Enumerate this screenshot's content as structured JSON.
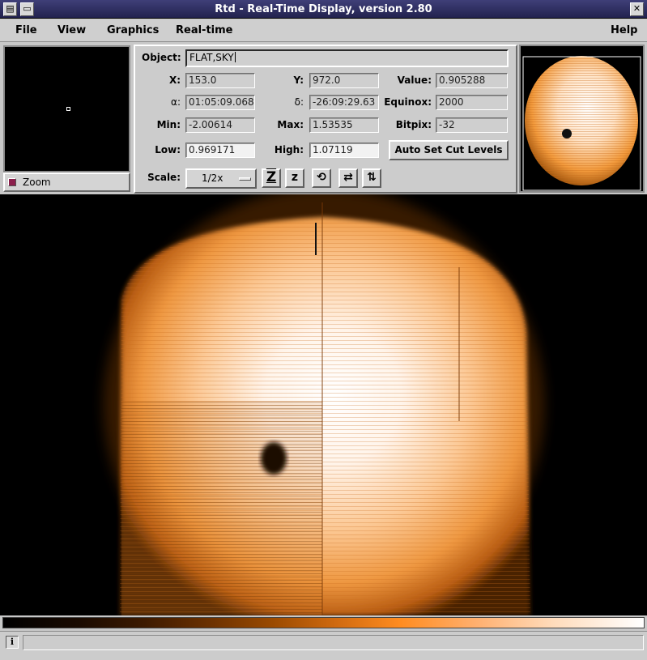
{
  "window": {
    "title": "Rtd - Real-Time Display, version 2.80"
  },
  "menu": {
    "file": "File",
    "view": "View",
    "graphics": "Graphics",
    "realtime": "Real-time",
    "help": "Help"
  },
  "zoom": {
    "label": "Zoom"
  },
  "info": {
    "object_label": "Object:",
    "object_value": "FLAT,SKY",
    "x_label": "X:",
    "x_value": "153.0",
    "y_label": "Y:",
    "y_value": "972.0",
    "value_label": "Value:",
    "value_value": "0.905288",
    "alpha_label": "α:",
    "alpha_value": "01:05:09.068",
    "delta_label": "δ:",
    "delta_value": "-26:09:29.63",
    "equinox_label": "Equinox:",
    "equinox_value": "2000",
    "min_label": "Min:",
    "min_value": "-2.00614",
    "max_label": "Max:",
    "max_value": "1.53535",
    "bitpix_label": "Bitpix:",
    "bitpix_value": "-32",
    "low_label": "Low:",
    "low_value": "0.969171",
    "high_label": "High:",
    "high_value": "1.07119",
    "autocut_label": "Auto Set Cut Levels",
    "scale_label": "Scale:",
    "scale_value": "1/2x"
  },
  "toolbar_icons": {
    "zoom_in": "Z",
    "zoom_out": "z",
    "rotate": "⟲",
    "flip_x": "⇄",
    "flip_y": "⇅"
  },
  "status": {
    "icon": "i",
    "message": ""
  },
  "colors": {
    "title_bar": "#2b2b5c",
    "image_colormap_mid": "#ff8c20",
    "image_bright": "#ffffff"
  }
}
